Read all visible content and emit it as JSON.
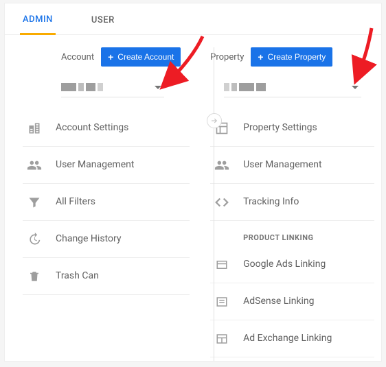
{
  "tabs": {
    "admin": "ADMIN",
    "user": "USER"
  },
  "account": {
    "label": "Account",
    "create": "Create Account",
    "items": {
      "settings": "Account Settings",
      "user_mgmt": "User Management",
      "filters": "All Filters",
      "history": "Change History",
      "trash": "Trash Can"
    }
  },
  "property": {
    "label": "Property",
    "create": "Create Property",
    "items": {
      "settings": "Property Settings",
      "user_mgmt": "User Management",
      "tracking": "Tracking Info",
      "section_product_linking": "PRODUCT LINKING",
      "ads_linking": "Google Ads Linking",
      "adsense_linking": "AdSense Linking",
      "adexchange_linking": "Ad Exchange Linking"
    }
  }
}
